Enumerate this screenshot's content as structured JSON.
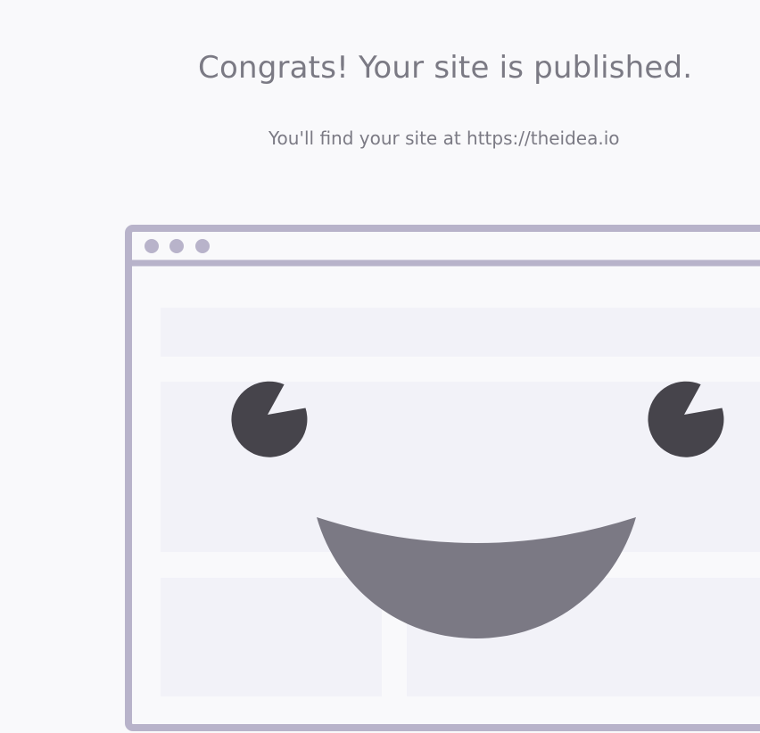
{
  "headline": "Congrats! Your site is published.",
  "subline": "You'll find your site at https://theidea.io",
  "colors": {
    "background": "#f9f9fb",
    "text": "#7b7a84",
    "frame": "#b8b3ca",
    "placeholder": "#f2f2f8",
    "eyes": "#46444b",
    "mouth": "#7b7984"
  },
  "illustration": {
    "icon": "smiling-browser-window"
  }
}
